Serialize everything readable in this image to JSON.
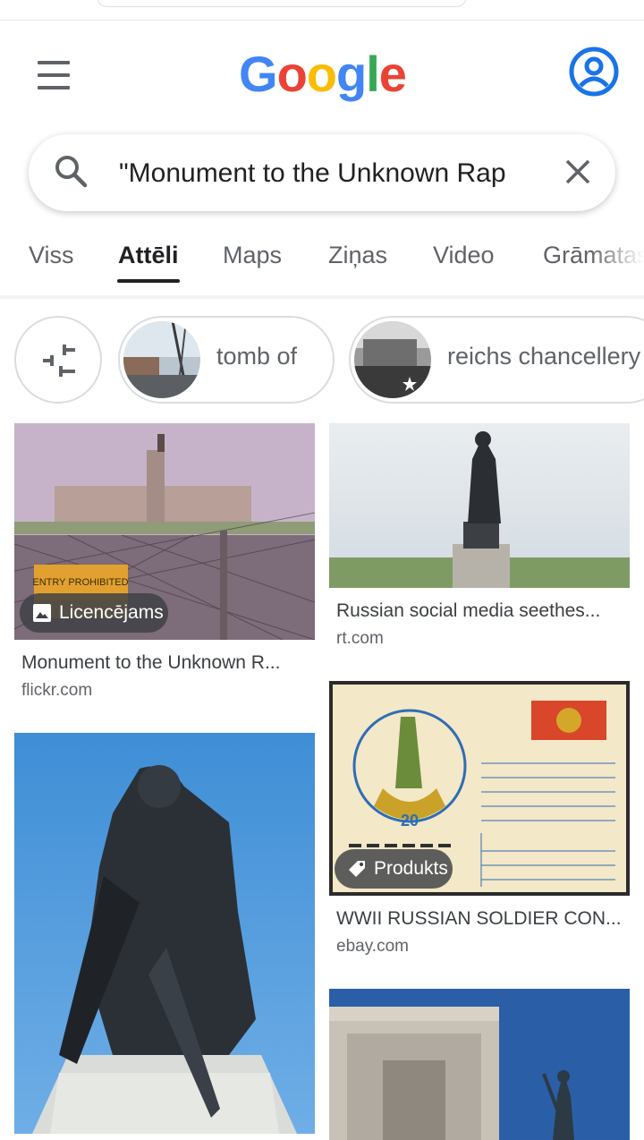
{
  "header": {
    "logo_letters": [
      {
        "ch": "G",
        "color": "#4285F4"
      },
      {
        "ch": "o",
        "color": "#EA4335"
      },
      {
        "ch": "o",
        "color": "#FBBC05"
      },
      {
        "ch": "g",
        "color": "#4285F4"
      },
      {
        "ch": "l",
        "color": "#34A853"
      },
      {
        "ch": "e",
        "color": "#EA4335"
      }
    ],
    "avatar_color": "#1a73e8"
  },
  "search": {
    "query": "\"Monument to the Unknown Rap"
  },
  "tabs": [
    {
      "label": "Viss"
    },
    {
      "label": "Attēli"
    },
    {
      "label": "Maps"
    },
    {
      "label": "Ziņas"
    },
    {
      "label": "Video"
    },
    {
      "label": "Grāmatas"
    }
  ],
  "chips": [
    {
      "label": "tomb of"
    },
    {
      "label": "reichs chancellery"
    }
  ],
  "results": [
    {
      "title": "Monument to the Unknown R...",
      "source": "flickr.com",
      "badge": "Licencējams",
      "badge_icon": "image-icon"
    },
    {
      "title": "Russian social media seethes...",
      "source": "rt.com"
    },
    {
      "title": "WWII RUSSIAN SOLDIER CON...",
      "source": "ebay.com",
      "badge": "Produkts",
      "badge_icon": "tag-icon"
    },
    {
      "title": "",
      "source": ""
    },
    {
      "title": "",
      "source": ""
    }
  ]
}
